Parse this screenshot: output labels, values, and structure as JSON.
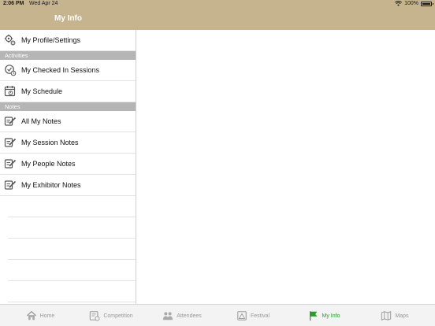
{
  "status": {
    "time": "2:06 PM",
    "date": "Wed Apr 24",
    "battery": "100%",
    "battery_level": 1.0
  },
  "header": {
    "title": "My Info"
  },
  "sidebar": {
    "top_item": {
      "label": "My Profile/Settings",
      "icon": "settings-gears-icon"
    },
    "sections": [
      {
        "title": "Activities",
        "items": [
          {
            "label": "My Checked In Sessions",
            "icon": "check-in-icon"
          },
          {
            "label": "My Schedule",
            "icon": "calendar-icon"
          }
        ]
      },
      {
        "title": "Notes",
        "items": [
          {
            "label": "All My Notes",
            "icon": "note-edit-icon"
          },
          {
            "label": "My Session Notes",
            "icon": "note-edit-icon"
          },
          {
            "label": "My People Notes",
            "icon": "note-edit-icon"
          },
          {
            "label": "My Exhibitor Notes",
            "icon": "note-edit-icon"
          }
        ]
      }
    ]
  },
  "tabbar": {
    "tabs": [
      {
        "label": "Home",
        "icon": "home-icon"
      },
      {
        "label": "Competition",
        "icon": "competition-icon"
      },
      {
        "label": "Attendees",
        "icon": "people-icon"
      },
      {
        "label": "Festival",
        "icon": "festival-icon"
      },
      {
        "label": "My Info",
        "icon": "flag-icon",
        "active": true
      },
      {
        "label": "Maps",
        "icon": "map-icon"
      }
    ]
  },
  "colors": {
    "header": "#c6b48f",
    "section": "#b5b5b5",
    "active_tab": "#2e9a2e",
    "inactive_tab": "#999999"
  }
}
